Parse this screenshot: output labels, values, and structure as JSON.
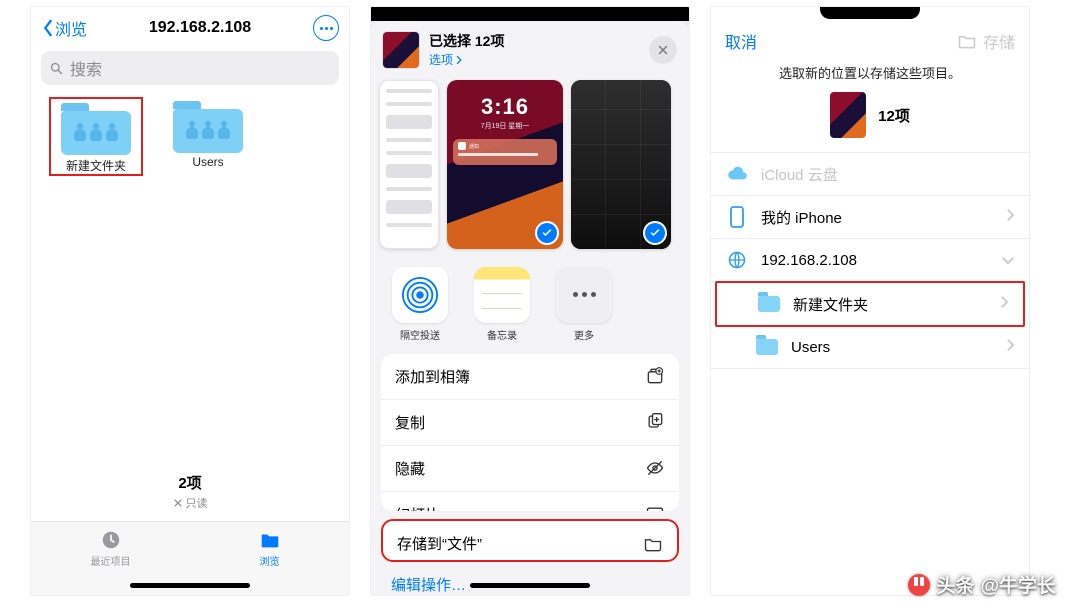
{
  "phone1": {
    "back": "浏览",
    "title": "192.168.2.108",
    "search_placeholder": "搜索",
    "folders": [
      {
        "name": "新建文件夹",
        "highlighted": true
      },
      {
        "name": "Users",
        "highlighted": false
      }
    ],
    "count": "2项",
    "readonly": "只读",
    "tabs": {
      "recent": "最近项目",
      "browse": "浏览"
    }
  },
  "phone2": {
    "header_title": "已选择 12项",
    "header_options": "选项",
    "lockscreen": {
      "time": "3:16",
      "date": "7月19日 星期一"
    },
    "share": {
      "airdrop": "隔空投送",
      "notes": "备忘录",
      "more": "更多"
    },
    "actions": [
      {
        "label": "添加到相簿",
        "icon": "album"
      },
      {
        "label": "复制",
        "icon": "copy"
      },
      {
        "label": "隐藏",
        "icon": "hide"
      },
      {
        "label": "幻灯片",
        "icon": "play"
      }
    ],
    "save_to_files": "存储到“文件”",
    "edit_actions": "编辑操作…"
  },
  "phone3": {
    "cancel": "取消",
    "save": "存储",
    "subtitle": "选取新的位置以存储这些项目。",
    "item_count": "12项",
    "locations": {
      "icloud": "iCloud 云盘",
      "iphone": "我的 iPhone",
      "server": "192.168.2.108",
      "sub": [
        {
          "label": "新建文件夹",
          "highlighted": true
        },
        {
          "label": "Users",
          "highlighted": false
        }
      ]
    }
  },
  "watermark": {
    "prefix": "头条",
    "handle": "@牛学长"
  }
}
